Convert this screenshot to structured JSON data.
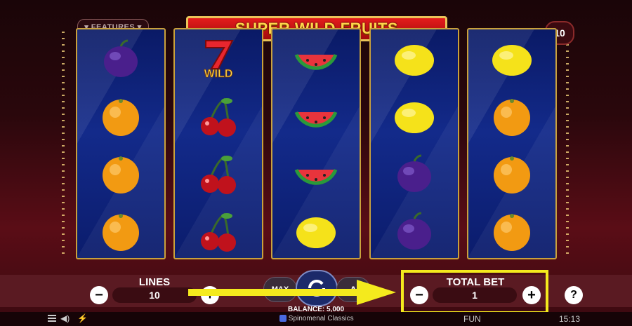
{
  "game": {
    "title": "SUPER WILD FRUITS",
    "features_label": "▾ FEATURES ▾",
    "lines_badge": "10"
  },
  "reels": [
    [
      "plum",
      "orange",
      "orange",
      "orange"
    ],
    [
      "wild-seven",
      "cherry",
      "cherry",
      "cherry"
    ],
    [
      "watermelon",
      "watermelon",
      "watermelon",
      "lemon"
    ],
    [
      "lemon",
      "lemon",
      "plum",
      "plum"
    ],
    [
      "lemon",
      "orange",
      "orange",
      "orange"
    ]
  ],
  "wild_text": "WILD",
  "controls": {
    "lines_label": "LINES",
    "lines_value": "10",
    "minus": "−",
    "plus": "+",
    "max_label": "MAX",
    "total_bet_label": "TOTAL BET",
    "total_bet_value": "1",
    "help": "?",
    "balance_label": "BALANCE: 5,000"
  },
  "status_bar": {
    "brand": "Spinomenal Classics",
    "mode": "FUN",
    "time": "15:13"
  },
  "colors": {
    "highlight": "#f4ea1d",
    "reel_bg": "#132a8a",
    "gold": "#c9a13c"
  }
}
